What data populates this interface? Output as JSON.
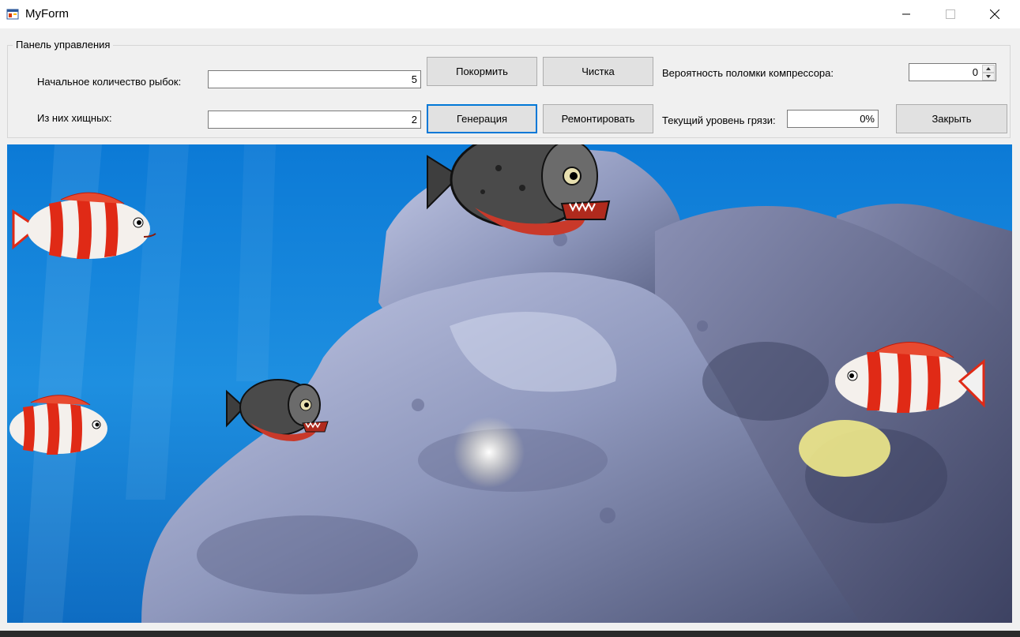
{
  "window": {
    "title": "MyForm",
    "icon": "form-icon",
    "controls": [
      "minimize-icon",
      "maximize-icon",
      "close-icon"
    ]
  },
  "control_panel": {
    "title": "Панель управления",
    "initial_fish_label": "Начальное количество рыбок:",
    "initial_fish_value": "5",
    "predators_label": "Из них хищных:",
    "predators_value": "2",
    "feed_button": "Покормить",
    "clean_button": "Чистка",
    "generate_button": "Генерация",
    "repair_button": "Ремонтировать",
    "compressor_label": "Вероятность поломки компрессора:",
    "compressor_value": "0",
    "dirt_label": "Текущий уровень грязи:",
    "dirt_value": "0%",
    "close_button": "Закрыть"
  },
  "aquarium": {
    "fish": [
      {
        "type": "striped-fish",
        "direction": "right"
      },
      {
        "type": "piranha",
        "direction": "right"
      },
      {
        "type": "striped-fish",
        "direction": "right"
      },
      {
        "type": "piranha",
        "direction": "right"
      },
      {
        "type": "striped-fish",
        "direction": "left"
      }
    ],
    "colors": {
      "water": "#1e8fe0",
      "rock": "#8f98bd",
      "fish_red": "#e02a16",
      "piranha": "#4a4a4a"
    }
  }
}
